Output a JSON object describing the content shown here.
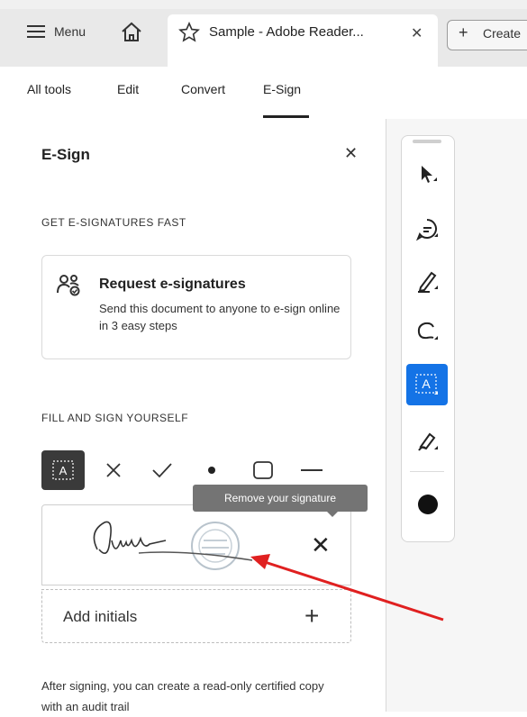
{
  "browser": {
    "menu_label": "Menu",
    "tab_title": "Sample - Adobe Reader...",
    "create_label": "Create"
  },
  "app_tabs": [
    {
      "label": "All tools"
    },
    {
      "label": "Edit"
    },
    {
      "label": "Convert"
    },
    {
      "label": "E-Sign",
      "active": true
    }
  ],
  "panel": {
    "title": "E-Sign",
    "section_get": "GET E-SIGNATURES FAST",
    "request_card": {
      "title": "Request e-signatures",
      "description": "Send this document to anyone to e-sign online in 3 easy steps"
    },
    "section_fill": "FILL AND SIGN YOURSELF",
    "tooltip": "Remove your signature",
    "initials_label": "Add initials",
    "footer": "After signing, you can create a read-only certified copy with an audit trail"
  },
  "colors": {
    "accent": "#1473e6",
    "annotation_arrow": "#e02020"
  }
}
